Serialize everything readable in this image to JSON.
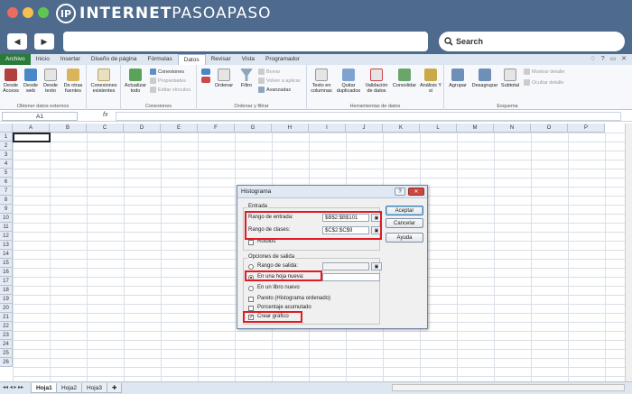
{
  "site": {
    "logo_mark": "IP",
    "logo_main": "INTERNET",
    "logo_accent": "PASOAPASO",
    "search_label": "Search"
  },
  "colors": {
    "chrome": "#4e6a8c",
    "file_tab": "#2a7a3a",
    "highlight": "#e01b24"
  },
  "ribbon": {
    "tabs": [
      "Archivo",
      "Inicio",
      "Insertar",
      "Diseño de página",
      "Fórmulas",
      "Datos",
      "Revisar",
      "Vista",
      "Programador"
    ],
    "active_tab": "Datos",
    "groups": {
      "external": {
        "label": "Obtener datos externos",
        "buttons": [
          "Desde Access",
          "Desde web",
          "Desde texto",
          "De otras fuentes"
        ]
      },
      "existing": {
        "label": "Conexiones existentes"
      },
      "connections": {
        "label": "Conexiones",
        "refresh": "Actualizar todo",
        "items": [
          "Conexiones",
          "Propiedades",
          "Editar vínculos"
        ]
      },
      "sort": {
        "label": "Ordenar y filtrar",
        "sort": "Ordenar",
        "filter": "Filtro",
        "items": [
          "Borrar",
          "Volver a aplicar",
          "Avanzadas"
        ]
      },
      "tools": {
        "label": "Herramientas de datos",
        "buttons": [
          "Texto en columnas",
          "Quitar duplicados",
          "Validación de datos",
          "Consolidar",
          "Análisis Y si"
        ]
      },
      "outline": {
        "label": "Esquema",
        "buttons": [
          "Agrupar",
          "Desagrupar",
          "Subtotal"
        ],
        "items": [
          "Mostrar detalle",
          "Ocultar detalle"
        ]
      }
    }
  },
  "formula_bar": {
    "name_box": "A1",
    "fx": "fx"
  },
  "grid": {
    "columns": [
      "A",
      "B",
      "C",
      "D",
      "E",
      "F",
      "G",
      "H",
      "I",
      "J",
      "K",
      "L",
      "M",
      "N",
      "O",
      "P"
    ],
    "rows": [
      "1",
      "2",
      "3",
      "4",
      "5",
      "6",
      "7",
      "8",
      "9",
      "10",
      "11",
      "12",
      "13",
      "14",
      "15",
      "16",
      "17",
      "18",
      "19",
      "20",
      "21",
      "22",
      "23",
      "24",
      "25",
      "26"
    ]
  },
  "sheets": [
    "Hoja1",
    "Hoja2",
    "Hoja3"
  ],
  "dialog": {
    "title": "Histograma",
    "input_section": "Entrada",
    "input_range_label": "Rango de entrada:",
    "input_range_value": "$B$2:$B$101",
    "bin_range_label": "Rango de clases:",
    "bin_range_value": "$C$2:$C$9",
    "labels_label": "Rótulos",
    "output_section": "Opciones de salida",
    "output_range_label": "Rango de salida:",
    "new_sheet_label": "En una hoja nueva:",
    "new_book_label": "En un libro nuevo",
    "pareto_label": "Pareto (Histograma ordenado)",
    "cumulative_label": "Porcentaje acumulado",
    "chart_label": "Crear gráfico",
    "ok": "Aceptar",
    "cancel": "Cancelar",
    "help": "Ayuda",
    "help_icon": "?",
    "close_icon": "✕"
  }
}
